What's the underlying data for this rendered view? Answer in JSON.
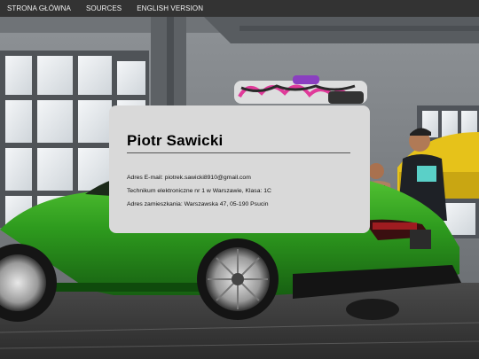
{
  "nav": {
    "items": [
      {
        "label": "STRONA GŁÓWNA"
      },
      {
        "label": "SOURCES"
      },
      {
        "label": "ENGLISH VERSION"
      }
    ]
  },
  "card": {
    "name": "Piotr Sawicki",
    "email_line": "Adres E-mail: piotrek.sawicki8910@gmail.com",
    "school_line": "Technikum elektroniczne nr 1 w Warszawie, Klasa: 1C",
    "address_line": "Adres zamieszkania: Warszawska 47, 05-190 Psucin"
  },
  "colors": {
    "nav_bg": "#333333",
    "nav_text": "#f2f2f2",
    "card_bg": "#d9d9d9",
    "car_green": "#2e9b1e",
    "background_car_yellow": "#e6c21a"
  },
  "background": {
    "description_icon": "garage-scene-with-green-car"
  }
}
